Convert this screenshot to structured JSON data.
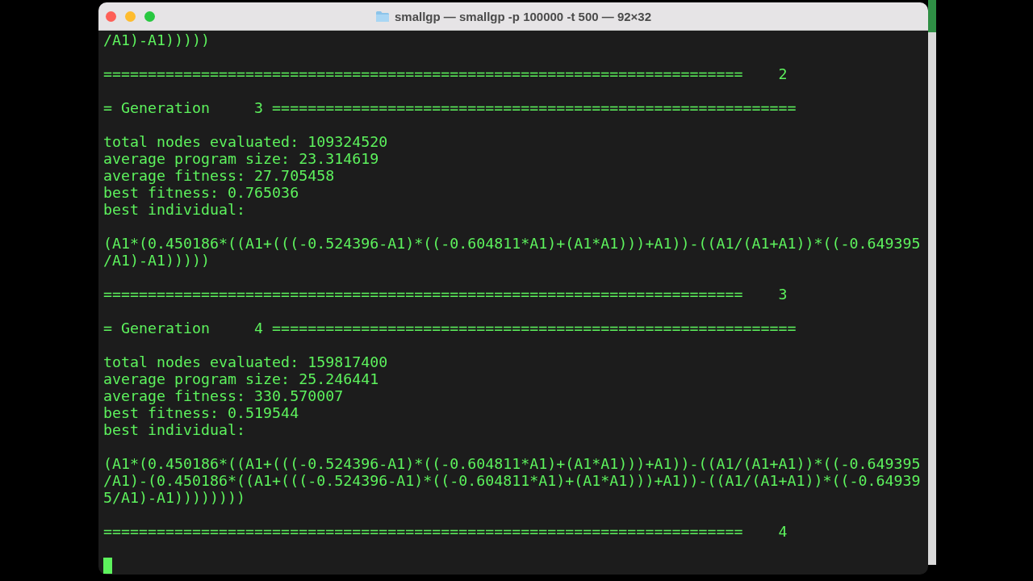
{
  "window": {
    "title": "smallgp — smallgp -p 100000 -t 500 — 92×32"
  },
  "terminal": {
    "lines": [
      {
        "kind": "text",
        "text": "/A1)-A1)))))"
      },
      {
        "kind": "blank"
      },
      {
        "kind": "text",
        "text": "========================================================================    2"
      },
      {
        "kind": "blank"
      },
      {
        "kind": "text",
        "text": "= Generation     3 ==========================================================="
      },
      {
        "kind": "blank"
      },
      {
        "kind": "text",
        "text": "total nodes evaluated: 109324520"
      },
      {
        "kind": "text",
        "text": "average program size: 23.314619"
      },
      {
        "kind": "text",
        "text": "average fitness: 27.705458"
      },
      {
        "kind": "text",
        "text": "best fitness: 0.765036"
      },
      {
        "kind": "text",
        "text": "best individual:"
      },
      {
        "kind": "blank"
      },
      {
        "kind": "text",
        "text": "(A1*(0.450186*((A1+(((-0.524396-A1)*((-0.604811*A1)+(A1*A1)))+A1))-((A1/(A1+A1))*((-0.649395"
      },
      {
        "kind": "text",
        "text": "/A1)-A1)))))"
      },
      {
        "kind": "blank"
      },
      {
        "kind": "text",
        "text": "========================================================================    3"
      },
      {
        "kind": "blank"
      },
      {
        "kind": "text",
        "text": "= Generation     4 ==========================================================="
      },
      {
        "kind": "blank"
      },
      {
        "kind": "text",
        "text": "total nodes evaluated: 159817400"
      },
      {
        "kind": "text",
        "text": "average program size: 25.246441"
      },
      {
        "kind": "text",
        "text": "average fitness: 330.570007"
      },
      {
        "kind": "text",
        "text": "best fitness: 0.519544"
      },
      {
        "kind": "text",
        "text": "best individual:"
      },
      {
        "kind": "blank"
      },
      {
        "kind": "text",
        "text": "(A1*(0.450186*((A1+(((-0.524396-A1)*((-0.604811*A1)+(A1*A1)))+A1))-((A1/(A1+A1))*((-0.649395"
      },
      {
        "kind": "text",
        "text": "/A1)-(0.450186*((A1+(((-0.524396-A1)*((-0.604811*A1)+(A1*A1)))+A1))-((A1/(A1+A1))*((-0.64939"
      },
      {
        "kind": "text",
        "text": "5/A1)-A1))))))))"
      },
      {
        "kind": "blank"
      },
      {
        "kind": "text",
        "text": "========================================================================    4"
      },
      {
        "kind": "blank"
      },
      {
        "kind": "cursor"
      }
    ]
  }
}
